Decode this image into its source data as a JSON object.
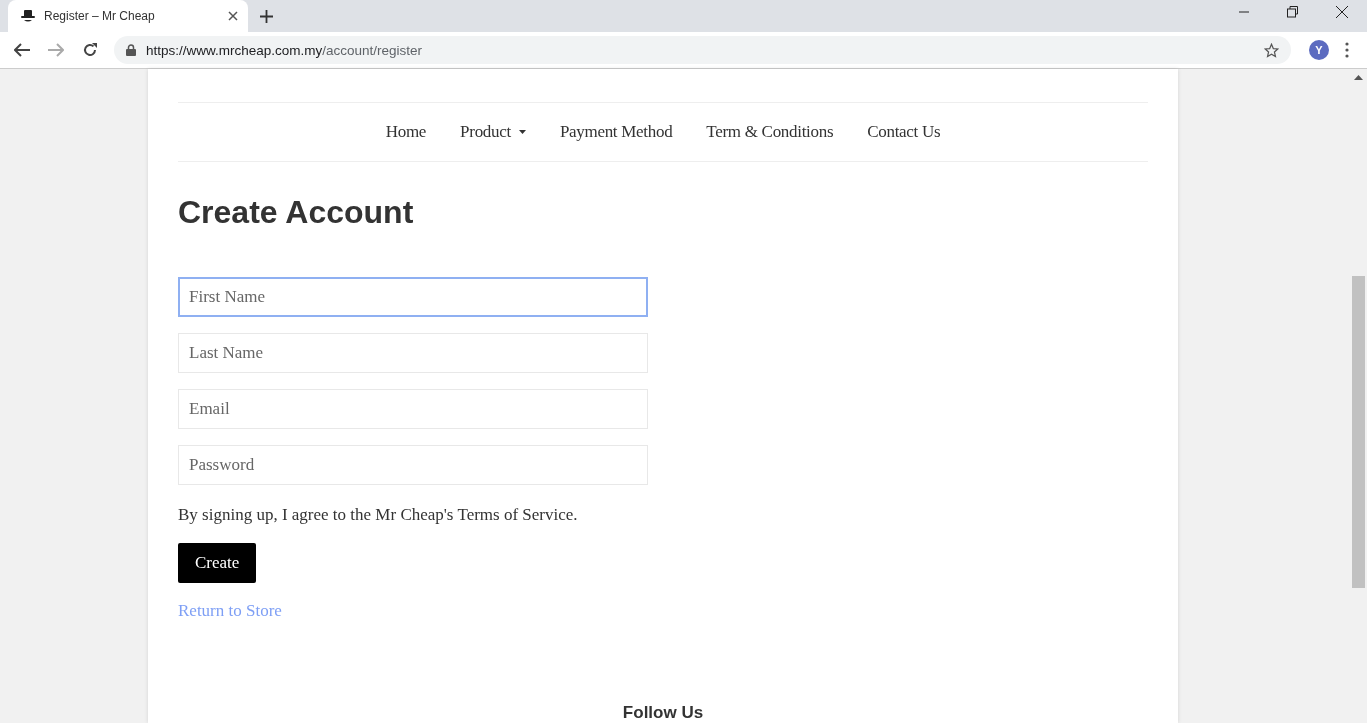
{
  "browser": {
    "tab_title": "Register – Mr Cheap",
    "url_host": "https://www.mrcheap.com.my",
    "url_path": "/account/register",
    "profile_initial": "Y"
  },
  "nav": [
    {
      "label": "Home",
      "kind": "link"
    },
    {
      "label": "Product",
      "kind": "dropdown"
    },
    {
      "label": "Payment Method",
      "kind": "link"
    },
    {
      "label": "Term & Conditions",
      "kind": "link"
    },
    {
      "label": "Contact Us",
      "kind": "link"
    }
  ],
  "heading": "Create Account",
  "fields": [
    {
      "placeholder": "First Name",
      "focused": true
    },
    {
      "placeholder": "Last Name",
      "focused": false
    },
    {
      "placeholder": "Email",
      "focused": false
    },
    {
      "placeholder": "Password",
      "focused": false
    }
  ],
  "terms": "By signing up, I agree to the Mr Cheap's Terms of Service.",
  "submit": "Create",
  "return_link": "Return to Store",
  "footer_heading": "Follow Us"
}
